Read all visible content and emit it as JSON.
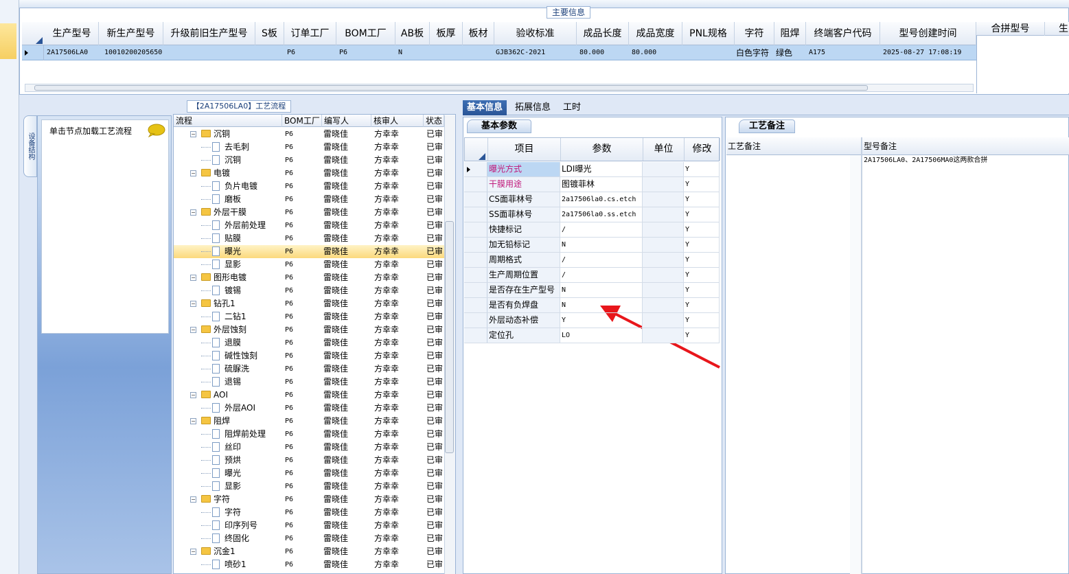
{
  "top": {
    "main_info_label": "主要信息",
    "columns": [
      "生产型号",
      "新生产型号",
      "升级前旧生产型号",
      "S板",
      "订单工厂",
      "BOM工厂",
      "AB板",
      "板厚",
      "板材",
      "验收标准",
      "成品长度",
      "成品宽度",
      "PNL规格",
      "字符",
      "阻焊",
      "终端客户代码",
      "型号创建时间"
    ],
    "row": [
      "2A17506LA0",
      "10010200205650",
      "",
      "",
      "P6",
      "P6",
      "N",
      "",
      "",
      "GJB362C-2021",
      "80.000",
      "80.000",
      "",
      "白色字符",
      "绿色",
      "A175",
      "2025-08-27 17:08:19"
    ],
    "side_columns": [
      "合拼型号",
      "生"
    ]
  },
  "left": {
    "structure_tab_label": "设备结构",
    "hint": "单击节点加载工艺流程"
  },
  "flow": {
    "title": "【2A17506LA0】工艺流程",
    "columns": [
      "流程",
      "BOM工厂",
      "编写人",
      "核审人",
      "状态"
    ],
    "rows": [
      {
        "name": "沉铜",
        "level": 0,
        "bom": "P6",
        "writer": "雷晓佳",
        "reviewer": "方幸幸",
        "status": "已审"
      },
      {
        "name": "去毛刺",
        "level": 1,
        "bom": "P6",
        "writer": "雷晓佳",
        "reviewer": "方幸幸",
        "status": "已审"
      },
      {
        "name": "沉铜",
        "level": 1,
        "bom": "P6",
        "writer": "雷晓佳",
        "reviewer": "方幸幸",
        "status": "已审"
      },
      {
        "name": "电镀",
        "level": 0,
        "bom": "P6",
        "writer": "雷晓佳",
        "reviewer": "方幸幸",
        "status": "已审"
      },
      {
        "name": "负片电镀",
        "level": 1,
        "bom": "P6",
        "writer": "雷晓佳",
        "reviewer": "方幸幸",
        "status": "已审"
      },
      {
        "name": "磨板",
        "level": 1,
        "bom": "P6",
        "writer": "雷晓佳",
        "reviewer": "方幸幸",
        "status": "已审"
      },
      {
        "name": "外层干膜",
        "level": 0,
        "bom": "P6",
        "writer": "雷晓佳",
        "reviewer": "方幸幸",
        "status": "已审"
      },
      {
        "name": "外层前处理",
        "level": 1,
        "bom": "P6",
        "writer": "雷晓佳",
        "reviewer": "方幸幸",
        "status": "已审"
      },
      {
        "name": "贴膜",
        "level": 1,
        "bom": "P6",
        "writer": "雷晓佳",
        "reviewer": "方幸幸",
        "status": "已审"
      },
      {
        "name": "曝光",
        "level": 1,
        "bom": "P6",
        "writer": "雷晓佳",
        "reviewer": "方幸幸",
        "status": "已审",
        "selected": true
      },
      {
        "name": "显影",
        "level": 1,
        "bom": "P6",
        "writer": "雷晓佳",
        "reviewer": "方幸幸",
        "status": "已审"
      },
      {
        "name": "图形电镀",
        "level": 0,
        "bom": "P6",
        "writer": "雷晓佳",
        "reviewer": "方幸幸",
        "status": "已审"
      },
      {
        "name": "镀锡",
        "level": 1,
        "bom": "P6",
        "writer": "雷晓佳",
        "reviewer": "方幸幸",
        "status": "已审"
      },
      {
        "name": "钻孔1",
        "level": 0,
        "bom": "P6",
        "writer": "雷晓佳",
        "reviewer": "方幸幸",
        "status": "已审"
      },
      {
        "name": "二钻1",
        "level": 1,
        "bom": "P6",
        "writer": "雷晓佳",
        "reviewer": "方幸幸",
        "status": "已审"
      },
      {
        "name": "外层蚀刻",
        "level": 0,
        "bom": "P6",
        "writer": "雷晓佳",
        "reviewer": "方幸幸",
        "status": "已审"
      },
      {
        "name": "退膜",
        "level": 1,
        "bom": "P6",
        "writer": "雷晓佳",
        "reviewer": "方幸幸",
        "status": "已审"
      },
      {
        "name": "碱性蚀刻",
        "level": 1,
        "bom": "P6",
        "writer": "雷晓佳",
        "reviewer": "方幸幸",
        "status": "已审"
      },
      {
        "name": "硫脲洗",
        "level": 1,
        "bom": "P6",
        "writer": "雷晓佳",
        "reviewer": "方幸幸",
        "status": "已审"
      },
      {
        "name": "退锡",
        "level": 1,
        "bom": "P6",
        "writer": "雷晓佳",
        "reviewer": "方幸幸",
        "status": "已审"
      },
      {
        "name": "AOI",
        "level": 0,
        "bom": "P6",
        "writer": "雷晓佳",
        "reviewer": "方幸幸",
        "status": "已审"
      },
      {
        "name": "外层AOI",
        "level": 1,
        "bom": "P6",
        "writer": "雷晓佳",
        "reviewer": "方幸幸",
        "status": "已审"
      },
      {
        "name": "阻焊",
        "level": 0,
        "bom": "P6",
        "writer": "雷晓佳",
        "reviewer": "方幸幸",
        "status": "已审"
      },
      {
        "name": "阻焊前处理",
        "level": 1,
        "bom": "P6",
        "writer": "雷晓佳",
        "reviewer": "方幸幸",
        "status": "已审"
      },
      {
        "name": "丝印",
        "level": 1,
        "bom": "P6",
        "writer": "雷晓佳",
        "reviewer": "方幸幸",
        "status": "已审"
      },
      {
        "name": "预烘",
        "level": 1,
        "bom": "P6",
        "writer": "雷晓佳",
        "reviewer": "方幸幸",
        "status": "已审"
      },
      {
        "name": "曝光",
        "level": 1,
        "bom": "P6",
        "writer": "雷晓佳",
        "reviewer": "方幸幸",
        "status": "已审"
      },
      {
        "name": "显影",
        "level": 1,
        "bom": "P6",
        "writer": "雷晓佳",
        "reviewer": "方幸幸",
        "status": "已审"
      },
      {
        "name": "字符",
        "level": 0,
        "bom": "P6",
        "writer": "雷晓佳",
        "reviewer": "方幸幸",
        "status": "已审"
      },
      {
        "name": "字符",
        "level": 1,
        "bom": "P6",
        "writer": "雷晓佳",
        "reviewer": "方幸幸",
        "status": "已审"
      },
      {
        "name": "印序列号",
        "level": 1,
        "bom": "P6",
        "writer": "雷晓佳",
        "reviewer": "方幸幸",
        "status": "已审"
      },
      {
        "name": "终固化",
        "level": 1,
        "bom": "P6",
        "writer": "雷晓佳",
        "reviewer": "方幸幸",
        "status": "已审"
      },
      {
        "name": "沉金1",
        "level": 0,
        "bom": "P6",
        "writer": "雷晓佳",
        "reviewer": "方幸幸",
        "status": "已审"
      },
      {
        "name": "喷砂1",
        "level": 1,
        "bom": "P6",
        "writer": "雷晓佳",
        "reviewer": "方幸幸",
        "status": "已审"
      }
    ]
  },
  "right": {
    "tabs": [
      "基本信息",
      "拓展信息",
      "工时"
    ],
    "basic_subtab": "基本参数",
    "param_columns": [
      "项目",
      "参数",
      "单位",
      "修改"
    ],
    "params": [
      {
        "item": "曝光方式",
        "value": "LDI曝光",
        "unit": "",
        "modify": "Y",
        "highlight": true
      },
      {
        "item": "干膜用途",
        "value": "图镀菲林",
        "unit": "",
        "modify": "Y",
        "highlight": true
      },
      {
        "item": "CS面菲林号",
        "value": "2a17506la0.cs.etch",
        "unit": "",
        "modify": "Y"
      },
      {
        "item": "SS面菲林号",
        "value": "2a17506la0.ss.etch",
        "unit": "",
        "modify": "Y"
      },
      {
        "item": "快捷标记",
        "value": "/",
        "unit": "",
        "modify": "Y"
      },
      {
        "item": "加无铅标记",
        "value": "N",
        "unit": "",
        "modify": "Y"
      },
      {
        "item": "周期格式",
        "value": "/",
        "unit": "",
        "modify": "Y"
      },
      {
        "item": "生产周期位置",
        "value": "/",
        "unit": "",
        "modify": "Y"
      },
      {
        "item": "是否存在生产型号",
        "value": "N",
        "unit": "",
        "modify": "Y"
      },
      {
        "item": "是否有负焊盘",
        "value": "N",
        "unit": "",
        "modify": "Y"
      },
      {
        "item": "外层动态补偿",
        "value": "Y",
        "unit": "",
        "modify": "Y"
      },
      {
        "item": "定位孔",
        "value": "LO",
        "unit": "",
        "modify": "Y"
      }
    ],
    "remark_subtab": "工艺备注",
    "remark_columns": [
      "工艺备注",
      "型号备注"
    ],
    "model_remark": "2A17506LA0、2A17506MA0这两款合拼"
  },
  "colors": {
    "highlight_item": "#c0187a",
    "selection": "#bcd7f3",
    "tab_active": "#2a5597",
    "arrow": "#e8161b"
  }
}
